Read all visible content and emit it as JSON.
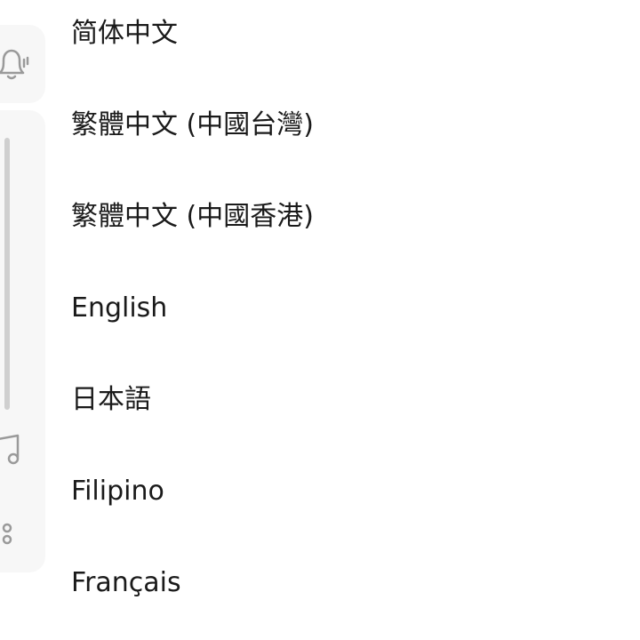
{
  "volume_panel": {
    "icons": [
      "bell-icon",
      "music-icon",
      "more-options-icon"
    ]
  },
  "language_list": {
    "items": [
      {
        "label": "简体中文"
      },
      {
        "label": "繁體中文 (中國台灣)"
      },
      {
        "label": "繁體中文 (中國香港)"
      },
      {
        "label": "English"
      },
      {
        "label": "日本語"
      },
      {
        "label": "Filipino"
      },
      {
        "label": "Français"
      }
    ]
  },
  "colors": {
    "background": "#ffffff",
    "panel": "#f7f7f7",
    "text": "#1a1a1a",
    "icon": "#9a9a9a",
    "slider": "#cfcfcf"
  }
}
